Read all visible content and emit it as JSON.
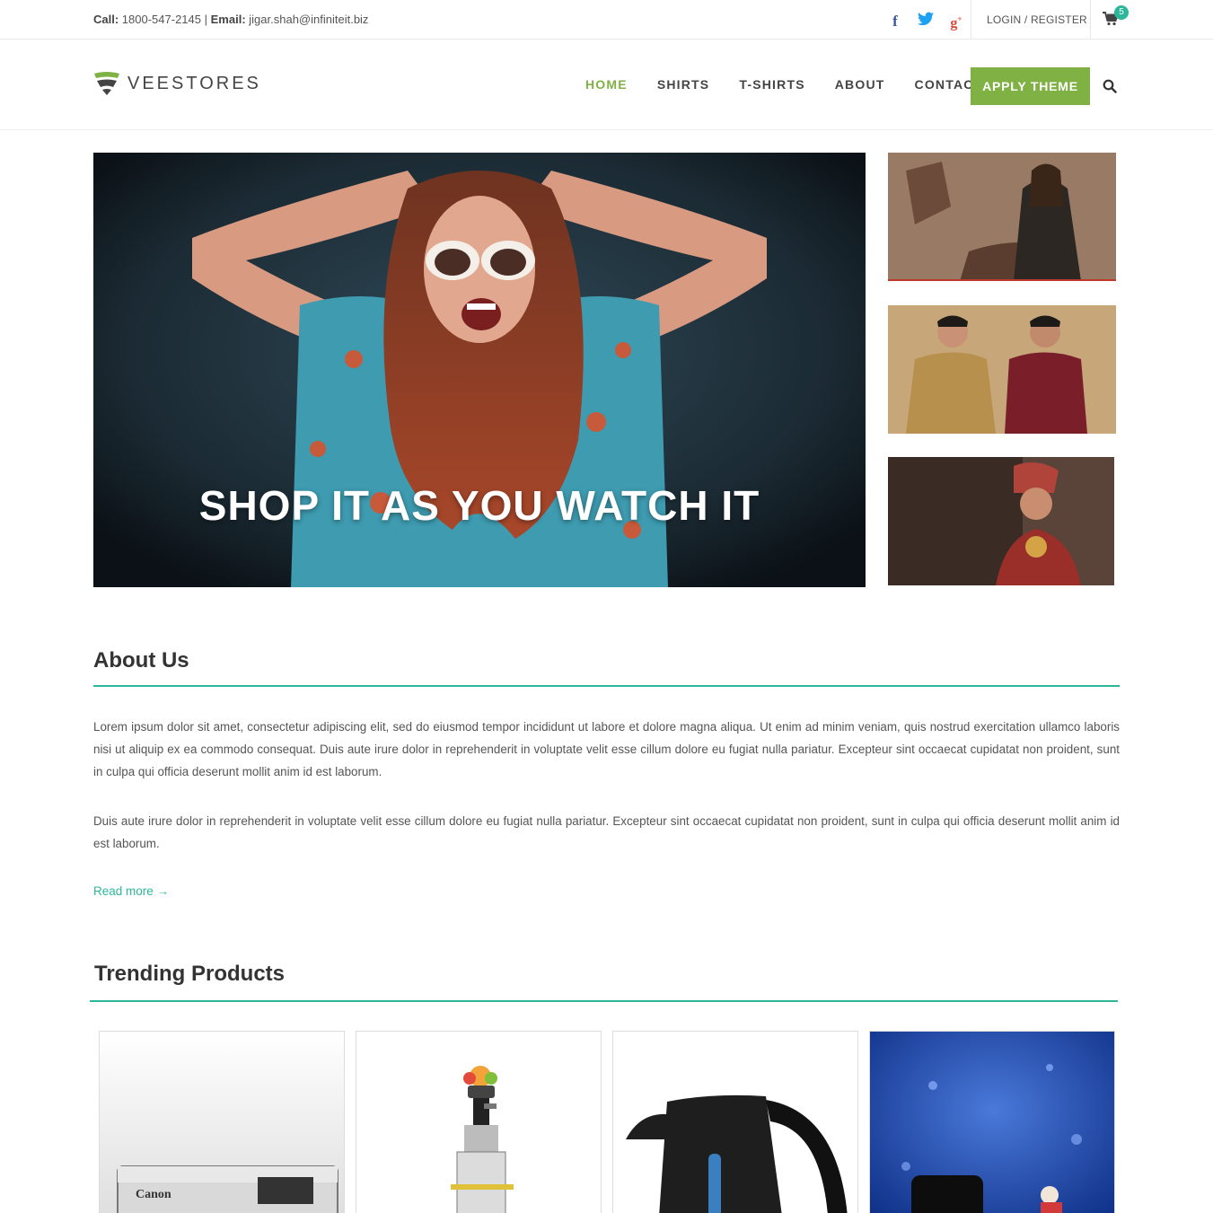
{
  "topbar": {
    "call_label": "Call:",
    "phone": "1800-547-2145",
    "separator": "|",
    "email_label": "Email:",
    "email": "jigar.shah@infiniteit.biz",
    "social": [
      "facebook-icon",
      "twitter-icon",
      "google-plus-icon"
    ],
    "login_label": "LOGIN / REGISTER",
    "cart_count": "5"
  },
  "header": {
    "logo_text": "VEESTORES",
    "nav": [
      "HOME",
      "SHIRTS",
      "T-SHIRTS",
      "ABOUT",
      "CONTACT"
    ],
    "active_nav": "HOME",
    "cta_label": "APPLY THEME"
  },
  "hero": {
    "caption": "SHOP IT AS YOU WATCH IT"
  },
  "about": {
    "title": "About Us",
    "paragraph_1": "Lorem ipsum dolor sit amet, consectetur adipiscing elit, sed do eiusmod tempor incididunt ut labore et dolore magna aliqua. Ut enim ad minim veniam, quis nostrud exercitation ullamco laboris nisi ut aliquip ex ea commodo consequat. Duis aute irure dolor in reprehenderit in voluptate velit esse cillum dolore eu fugiat nulla pariatur. Excepteur sint occaecat cupidatat non proident, sunt in culpa qui officia deserunt mollit anim id est laborum.",
    "paragraph_2": "Duis aute irure dolor in reprehenderit in voluptate velit esse cillum dolore eu fugiat nulla pariatur. Excepteur sint occaecat cupidatat non proident, sunt in culpa qui officia deserunt mollit anim id est laborum.",
    "read_more": "Read more →"
  },
  "trending": {
    "title": "Trending Products",
    "camera_brand": "Canon"
  },
  "colors": {
    "accent_green": "#7fb145",
    "teal": "#2db79a"
  }
}
